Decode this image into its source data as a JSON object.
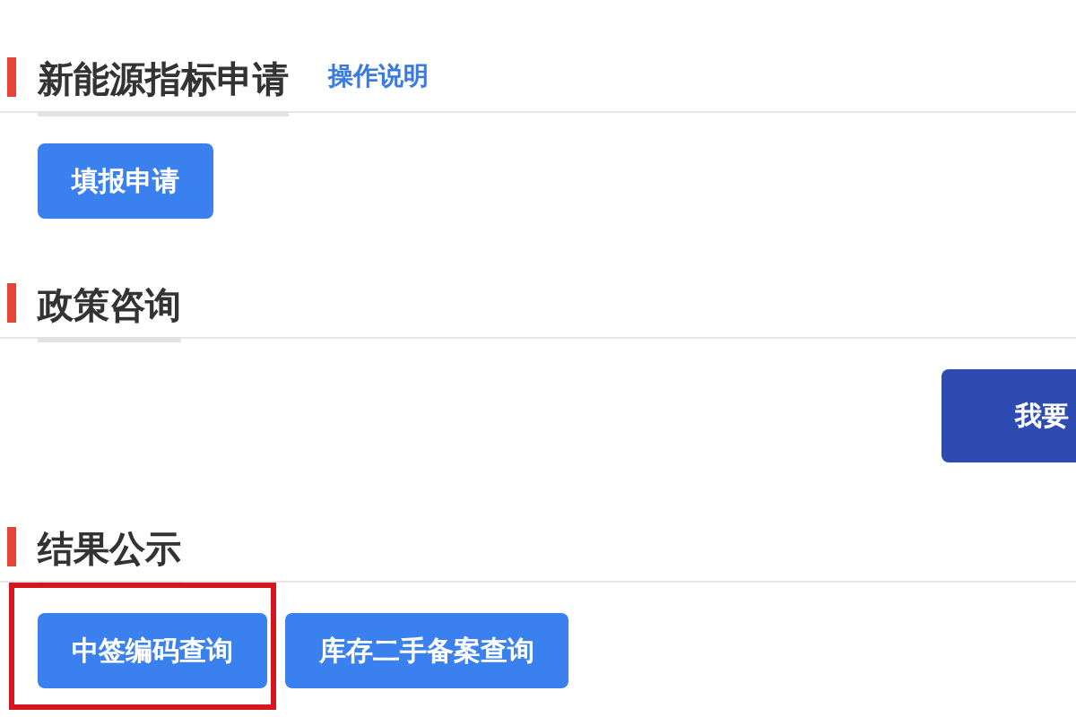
{
  "sections": [
    {
      "title": "新能源指标申请",
      "link": "操作说明",
      "buttons": [
        {
          "label": "填报申请",
          "kind": "primary",
          "highlighted": false
        }
      ]
    },
    {
      "title": "政策咨询",
      "buttons": [
        {
          "label": "我要",
          "kind": "dark",
          "highlighted": false
        }
      ]
    },
    {
      "title": "结果公示",
      "buttons": [
        {
          "label": "中签编码查询",
          "kind": "primary",
          "highlighted": true
        },
        {
          "label": "库存二手备案查询",
          "kind": "primary",
          "highlighted": false
        }
      ]
    }
  ]
}
